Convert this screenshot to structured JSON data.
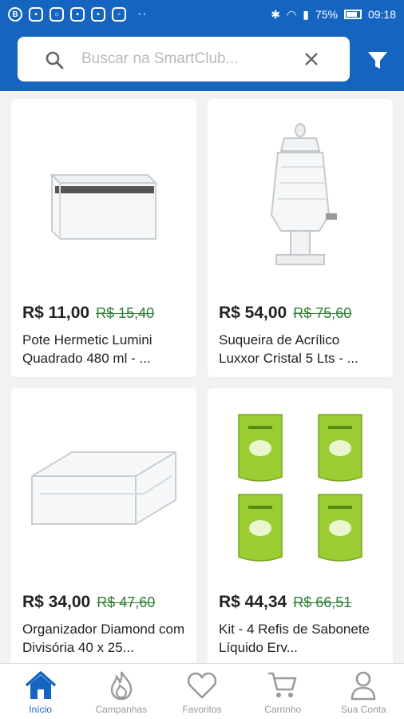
{
  "status_bar": {
    "battery": "75%",
    "time": "09:18"
  },
  "search": {
    "placeholder": "Buscar na SmartClub...",
    "value": ""
  },
  "products": [
    {
      "price": "R$ 11,00",
      "old_price": "R$ 15,40",
      "name": "Pote Hermetic Lumini Quadrado 480 ml - ..."
    },
    {
      "price": "R$ 54,00",
      "old_price": "R$ 75,60",
      "name": "Suqueira de Acrílico Luxxor Cristal 5 Lts - ..."
    },
    {
      "price": "R$ 34,00",
      "old_price": "R$ 47,60",
      "name": "Organizador Diamond com Divisória 40 x 25..."
    },
    {
      "price": "R$ 44,34",
      "old_price": "R$ 66,51",
      "name": "Kit - 4 Refis de Sabonete Líquido Erv..."
    }
  ],
  "nav": {
    "items": [
      {
        "label": "Início",
        "icon": "home-icon",
        "active": true
      },
      {
        "label": "Campanhas",
        "icon": "flame-icon",
        "active": false
      },
      {
        "label": "Favoritos",
        "icon": "heart-icon",
        "active": false
      },
      {
        "label": "Carrinho",
        "icon": "cart-icon",
        "active": false
      },
      {
        "label": "Sua Conta",
        "icon": "user-icon",
        "active": false
      }
    ]
  },
  "colors": {
    "brand": "#1565c0",
    "old_price": "#2e7d32",
    "inactive": "#9a9a9a"
  }
}
